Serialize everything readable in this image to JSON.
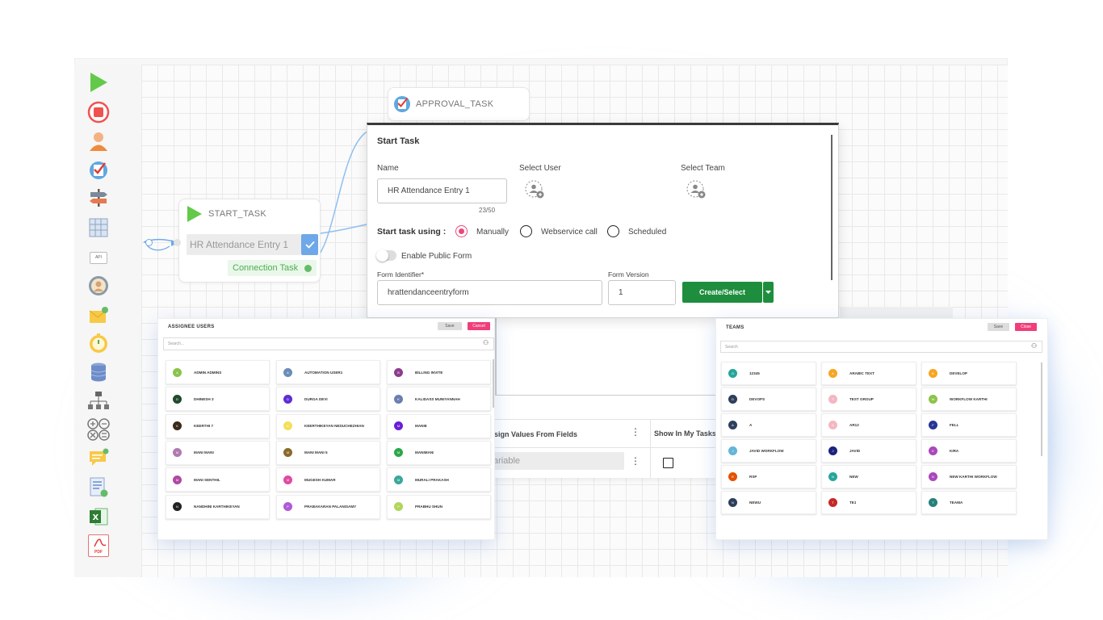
{
  "palette": {
    "icons": [
      "play-icon",
      "stop-icon",
      "user-task-icon",
      "approval-icon",
      "signpost-icon",
      "table-icon",
      "api-icon",
      "profile-icon",
      "email-icon",
      "timer-icon",
      "database-icon",
      "org-chart-icon",
      "operators-icon",
      "notification-icon",
      "document-icon",
      "excel-icon",
      "pdf-icon"
    ],
    "api_text": "API",
    "pdf_text": "PDF"
  },
  "nodes": {
    "approval_title": "APPROVAL_TASK",
    "start_title": "START_TASK",
    "start_form": "HR Attendance Entry 1",
    "connection": "Connection Task"
  },
  "dialog": {
    "title": "Start Task",
    "name_label": "Name",
    "name_value": "HR Attendance Entry 1",
    "name_count": "23/50",
    "select_user_label": "Select User",
    "select_team_label": "Select Team",
    "start_using_label": "Start task using :",
    "options": [
      "Manually",
      "Webservice call",
      "Scheduled"
    ],
    "selected_option": "Manually",
    "public_form_label": "Enable Public Form",
    "form_identifier_label": "Form Identifier*",
    "form_identifier_value": "hrattendanceentryform",
    "form_version_label": "Form Version",
    "form_version_value": "1",
    "create_button": "Create/Select"
  },
  "back_table": {
    "col1": "ssign Values From Fields",
    "col2": "Show In My Tasks",
    "variable_placeholder": "ariable"
  },
  "assignee": {
    "title": "ASSIGNEE USERS",
    "save": "Save",
    "cancel": "Cancel",
    "search_placeholder": "Search...",
    "users": [
      {
        "initial": "A",
        "name": "ADMIN ADMINS",
        "color": "#8bc34a"
      },
      {
        "initial": "A",
        "name": "AUTOMATION USER1",
        "color": "#6a8cb8"
      },
      {
        "initial": "B",
        "name": "BILLING INVITE",
        "color": "#8e3c8e"
      },
      {
        "initial": "D",
        "name": "DHINESH 3",
        "color": "#214a2e"
      },
      {
        "initial": "D",
        "name": "DURGA DEVI",
        "color": "#5b2fd6"
      },
      {
        "initial": "K",
        "name": "KALIDASS MUNIYANNAH",
        "color": "#6a7fb0"
      },
      {
        "initial": "K",
        "name": "KEERTHI 7",
        "color": "#3b2a1a"
      },
      {
        "initial": "K",
        "name": "KEERTHIKEYAN NEDUCHEZHIAN",
        "color": "#f2e05a"
      },
      {
        "initial": "M",
        "name": "MANIE",
        "color": "#6a1fd6"
      },
      {
        "initial": "M",
        "name": "MANI MANI",
        "color": "#b07ab0"
      },
      {
        "initial": "M",
        "name": "MANI MANI 5",
        "color": "#8a6a2a"
      },
      {
        "initial": "M",
        "name": "MANIMANI",
        "color": "#2aa84a"
      },
      {
        "initial": "M",
        "name": "MANI SENTHIL",
        "color": "#b04aa0"
      },
      {
        "initial": "M",
        "name": "MUGESH KUMAR",
        "color": "#e04aa0"
      },
      {
        "initial": "M",
        "name": "MURALI PRAKASH",
        "color": "#3aa89a"
      },
      {
        "initial": "N",
        "name": "NANDHINI KARTHIKEYAN",
        "color": "#222222"
      },
      {
        "initial": "P",
        "name": "PRABAKARAN PALANISAMY",
        "color": "#b05ad6"
      },
      {
        "initial": "P",
        "name": "PRABHU SHUN",
        "color": "#b0d65a"
      }
    ]
  },
  "teams": {
    "title": "TEAMS",
    "save": "Save",
    "close": "Close",
    "search_placeholder": "Search",
    "items": [
      {
        "initial": "G",
        "name": "12345",
        "color": "#26a69a"
      },
      {
        "initial": "A",
        "name": "ARABIC TEXT",
        "color": "#f5a623"
      },
      {
        "initial": "D",
        "name": "DEVELOP",
        "color": "#f5a623"
      },
      {
        "initial": "D",
        "name": "DEVOPS",
        "color": "#2e3f5c"
      },
      {
        "initial": "T",
        "name": "TEST GROUP",
        "color": "#f4b6c2"
      },
      {
        "initial": "W",
        "name": "WORKFLOW KARTHI",
        "color": "#8bc34a"
      },
      {
        "initial": "A",
        "name": "A",
        "color": "#2e3f5c"
      },
      {
        "initial": "A",
        "name": "AR12",
        "color": "#f4b6c2"
      },
      {
        "initial": "F",
        "name": "FELL",
        "color": "#283593"
      },
      {
        "initial": "J",
        "name": "JAVID WORKFLOW",
        "color": "#64b5d6"
      },
      {
        "initial": "J",
        "name": "JAVID",
        "color": "#1a237e"
      },
      {
        "initial": "K",
        "name": "KIRA",
        "color": "#ab47bc"
      },
      {
        "initial": "R",
        "name": "RSP",
        "color": "#e65100"
      },
      {
        "initial": "N",
        "name": "NEW",
        "color": "#26a69a"
      },
      {
        "initial": "N",
        "name": "NEW KARTHI WORKFLOW",
        "color": "#ab47bc"
      },
      {
        "initial": "N",
        "name": "NEWU",
        "color": "#2e3f5c"
      },
      {
        "initial": "T",
        "name": "TE1",
        "color": "#c62828"
      },
      {
        "initial": "T",
        "name": "TEAMA",
        "color": "#26807a"
      }
    ]
  }
}
